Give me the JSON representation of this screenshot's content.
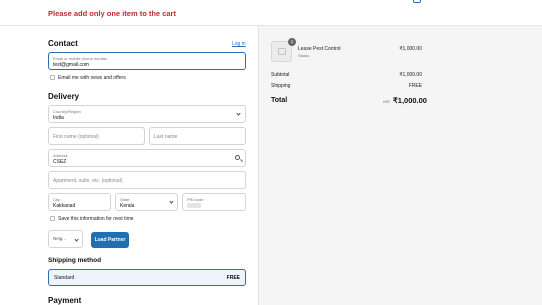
{
  "header": {
    "store_name": "*********",
    "error_message": "Please add only one item to the cart"
  },
  "contact": {
    "title": "Contact",
    "login_label": "Log in",
    "email_label": "Email or mobile phone number",
    "email_value": "test@gmail.com",
    "newsletter_label": "Email me with news and offers"
  },
  "delivery": {
    "title": "Delivery",
    "country_label": "Country/Region",
    "country_value": "India",
    "first_name_placeholder": "First name (optional)",
    "last_name_placeholder": "Last name",
    "address_label": "Address",
    "address_value": "CSEZ",
    "apartment_placeholder": "Apartment, suite, etc. (optional)",
    "city_label": "City",
    "city_value": "Kakkanad",
    "state_label": "State",
    "state_value": "Kerala",
    "pin_label": "PIN code",
    "save_label": "Save this information for next time",
    "partner_select_label": "Neig...",
    "load_partner_label": "Load Partner"
  },
  "shipping": {
    "title": "Shipping method",
    "option_label": "Standard",
    "option_price": "FREE"
  },
  "payment": {
    "title": "Payment"
  },
  "summary": {
    "quantity": "1",
    "product_name": "Lease Pest Control",
    "product_variant": "Studio",
    "product_price": "₹1,000.00",
    "subtotal_label": "Subtotal",
    "subtotal_value": "₹1,000.00",
    "shipping_label": "Shipping",
    "shipping_value": "FREE",
    "total_label": "Total",
    "total_currency": "INR",
    "total_value": "₹1,000.00"
  },
  "colors": {
    "accent": "#1f6fb2",
    "error": "#c22a2a",
    "summary_bg": "#f5f5f5"
  }
}
